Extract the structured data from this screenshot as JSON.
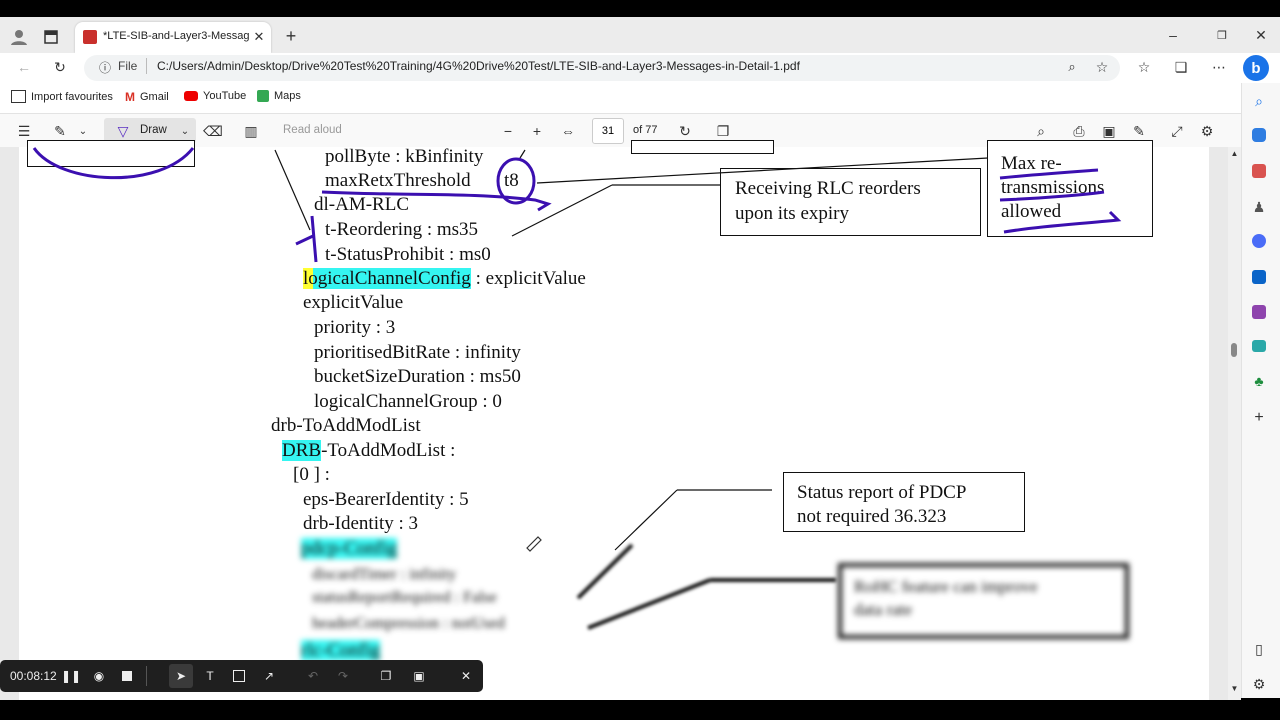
{
  "browser": {
    "tab_title": "*LTE-SIB-and-Layer3-Messages",
    "address_prefix": "File",
    "address_url": "C:/Users/Admin/Desktop/Drive%20Test%20Training/4G%20Drive%20Test/LTE-SIB-and-Layer3-Messages-in-Detail-1.pdf",
    "favourites": [
      {
        "label": "Import favourites"
      },
      {
        "label": "Gmail"
      },
      {
        "label": "YouTube"
      },
      {
        "label": "Maps"
      }
    ]
  },
  "pdf_toolbar": {
    "draw_label": "Draw",
    "read_aloud_label": "Read aloud",
    "page_number": "31",
    "page_total": "of 77"
  },
  "pdf_content": {
    "lines": {
      "l1": "pollByte : kBinfinity",
      "l2": "maxRetxThreshold",
      "l2v": "t8",
      "l3": "dl-AM-RLC",
      "l4": "t-Reordering : ms35",
      "l5": "t-StatusProhibit : ms0",
      "l6a": "logicalChannelConfig",
      "l6b": " : explicitValue",
      "l7": "explicitValue",
      "l8": "priority : 3",
      "l9": "prioritisedBitRate : infinity",
      "l10": "bucketSizeDuration : ms50",
      "l11": "logicalChannelGroup : 0",
      "l12": "drb-ToAddModList",
      "l13a": "DRB",
      "l13b": "-ToAddModList :",
      "l14": "[0 ] :",
      "l15": "eps-BearerIdentity : 5",
      "l16": "drb-Identity : 3",
      "l17": "pdcp-Config",
      "l18": "discardTimer : infinity",
      "l19": "statusReportRequired : False",
      "l20": "headerCompression : notUsed",
      "l21": "rlc-Config"
    },
    "boxes": {
      "rlc_reorder_1": "Receiving RLC reorders",
      "rlc_reorder_2": "upon its expiry",
      "max_retx_1": "Max re-",
      "max_retx_2": "transmissions",
      "max_retx_3": "allowed",
      "status_1": "Status report of PDCP",
      "status_2": "not required 36.323",
      "blurred_1": "RoHC feature can improve",
      "blurred_2": "data rate"
    }
  },
  "recorder": {
    "time": "00:08:12"
  },
  "colors": {
    "highlight_cyan": "#35f5f1",
    "highlight_yellow": "#ffff33",
    "ink_purple": "#3b0fb0"
  }
}
